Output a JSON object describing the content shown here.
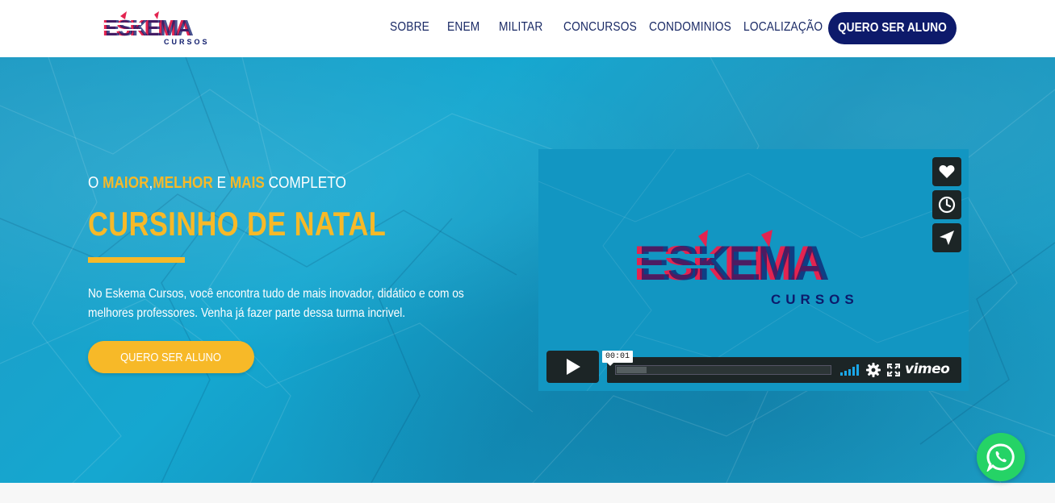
{
  "brand": {
    "logo_text": "ESKEMA",
    "logo_sub": "CURSOS"
  },
  "nav": {
    "items": [
      {
        "label": "SOBRE"
      },
      {
        "label": "ENEM"
      },
      {
        "label": "MILITAR"
      },
      {
        "label": "CONCURSOS"
      },
      {
        "label": "CONDOMINIOS"
      },
      {
        "label": "LOCALIZAÇÃO"
      }
    ],
    "cta_label": "QUERO SER ALUNO"
  },
  "hero": {
    "kicker": {
      "w1": "O ",
      "hl1": "MAIOR",
      "w2": ",",
      "hl2": "MELHOR",
      "w3": " E ",
      "hl3": "MAIS",
      "w4": " COMPLETO"
    },
    "title": "CURSINHO DE NATAL",
    "text": "No Eskema Cursos, você encontra tudo de mais inovador, didático e com os melhores professores. Venha já fazer parte dessa turma incrivel.",
    "button_label": "QUERO SER ALUNO"
  },
  "video": {
    "logo_text": "ESKEMA",
    "logo_sub": "CURSOS",
    "time": "00:01",
    "progress_fraction": 0.14,
    "brand": "vimeo",
    "side_icons": [
      "heart-icon",
      "clock-icon",
      "send-icon"
    ]
  },
  "colors": {
    "navy": "#0d1a6b",
    "accent": "#f7b928",
    "hero_blue": "#15a7d0",
    "whatsapp": "#25d366"
  }
}
